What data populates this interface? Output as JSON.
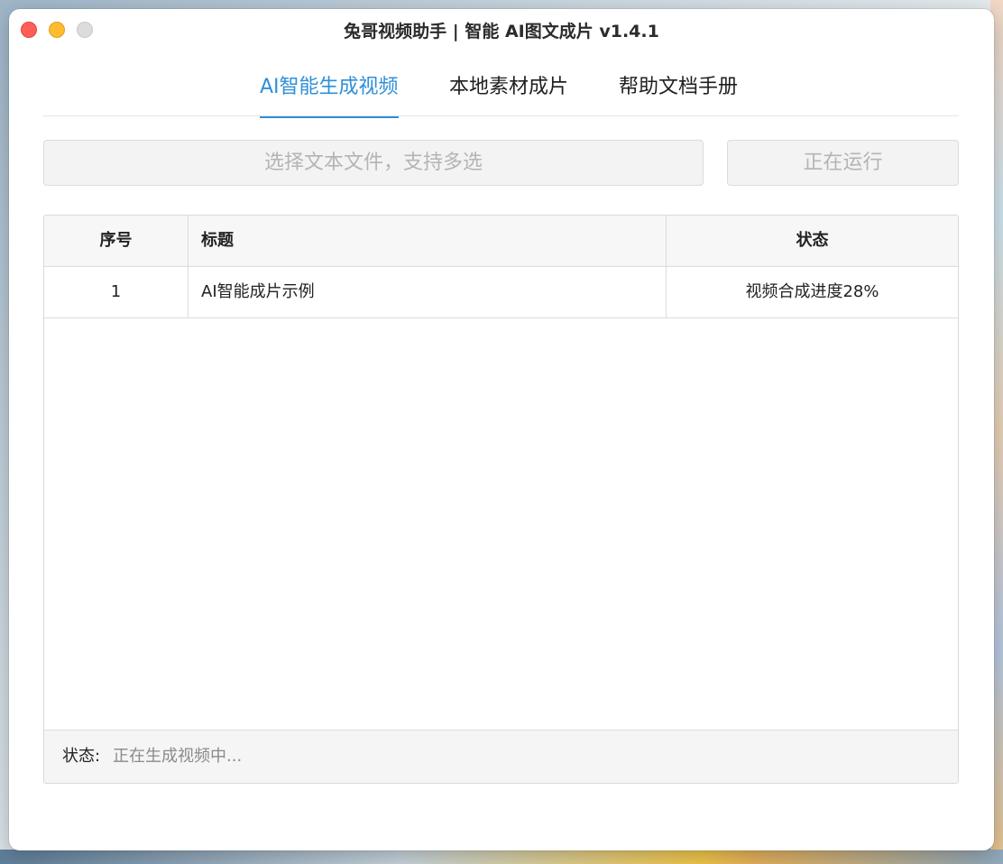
{
  "window": {
    "title": "兔哥视频助手 | 智能 AI图文成片 v1.4.1"
  },
  "tabs": [
    {
      "label": "AI智能生成视频",
      "active": true
    },
    {
      "label": "本地素材成片",
      "active": false
    },
    {
      "label": "帮助文档手册",
      "active": false
    }
  ],
  "toolbar": {
    "select_files_label": "选择文本文件，支持多选",
    "run_label": "正在运行"
  },
  "table": {
    "columns": [
      "序号",
      "标题",
      "状态"
    ],
    "rows": [
      {
        "index": "1",
        "title": "AI智能成片示例",
        "status": "视频合成进度28%"
      }
    ]
  },
  "status": {
    "label": "状态:",
    "value": "正在生成视频中..."
  },
  "colors": {
    "accent": "#2f8fd8",
    "close": "#ff5f57",
    "minimize": "#febc2e",
    "maximize": "#dcdcdc"
  }
}
